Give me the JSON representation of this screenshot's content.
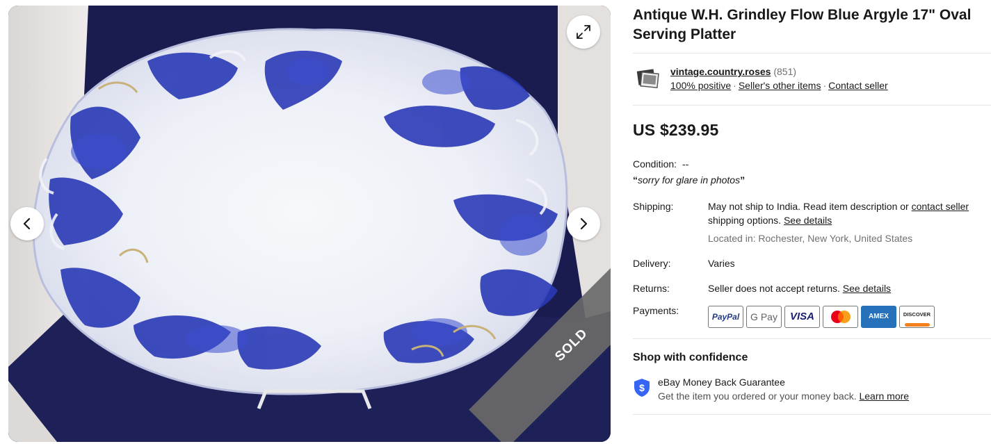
{
  "gallery": {
    "sold_label": "SOLD"
  },
  "listing": {
    "title_line1": "Antique W.H. Grindley Flow Blue Argyle 17\" Oval",
    "title_line2": "Serving Platter",
    "price": "US $239.95"
  },
  "seller": {
    "name": "vintage.country.roses",
    "feedback_count": "(851)",
    "positive": "100% positive",
    "other_items": "Seller's other items",
    "contact": "Contact seller"
  },
  "condition": {
    "label": "Condition:",
    "value": "--",
    "note": "sorry for glare in photos"
  },
  "shipping": {
    "label": "Shipping:",
    "text": "May not ship to India. Read item description or ",
    "contact_link": "contact seller",
    "text2": "shipping options.",
    "see_details": "See details",
    "located": "Located in: Rochester, New York, United States"
  },
  "delivery": {
    "label": "Delivery:",
    "value": "Varies"
  },
  "returns": {
    "label": "Returns:",
    "value": "Seller does not accept returns.",
    "see_details": "See details"
  },
  "payments": {
    "label": "Payments:",
    "methods": [
      "PayPal",
      "G Pay",
      "VISA",
      "Mastercard",
      "AMEX",
      "DISCOVER"
    ]
  },
  "confidence": {
    "title": "Shop with confidence",
    "guarantee_title": "eBay Money Back Guarantee",
    "guarantee_sub": "Get the item you ordered or your money back.",
    "learn_more": "Learn more"
  },
  "colors": {
    "text": "#191919",
    "muted": "#707070",
    "shield_blue": "#3665f3",
    "paypal_blue": "#253b80",
    "visa_blue": "#1a1f71",
    "amex_blue": "#2671b9",
    "discover_orange": "#f48120"
  }
}
